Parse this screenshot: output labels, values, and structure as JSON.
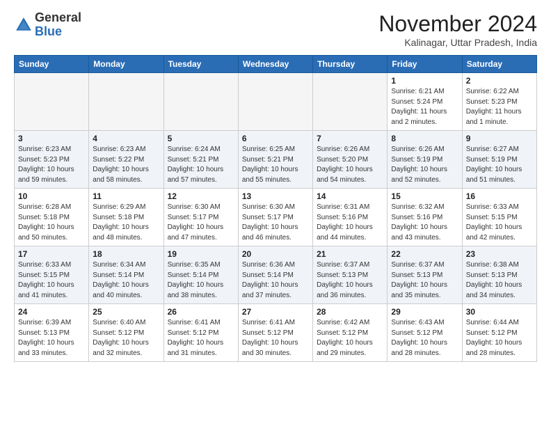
{
  "header": {
    "logo_general": "General",
    "logo_blue": "Blue",
    "month_title": "November 2024",
    "subtitle": "Kalinagar, Uttar Pradesh, India"
  },
  "days_of_week": [
    "Sunday",
    "Monday",
    "Tuesday",
    "Wednesday",
    "Thursday",
    "Friday",
    "Saturday"
  ],
  "weeks": [
    [
      {
        "day": "",
        "info": ""
      },
      {
        "day": "",
        "info": ""
      },
      {
        "day": "",
        "info": ""
      },
      {
        "day": "",
        "info": ""
      },
      {
        "day": "",
        "info": ""
      },
      {
        "day": "1",
        "info": "Sunrise: 6:21 AM\nSunset: 5:24 PM\nDaylight: 11 hours\nand 2 minutes."
      },
      {
        "day": "2",
        "info": "Sunrise: 6:22 AM\nSunset: 5:23 PM\nDaylight: 11 hours\nand 1 minute."
      }
    ],
    [
      {
        "day": "3",
        "info": "Sunrise: 6:23 AM\nSunset: 5:23 PM\nDaylight: 10 hours\nand 59 minutes."
      },
      {
        "day": "4",
        "info": "Sunrise: 6:23 AM\nSunset: 5:22 PM\nDaylight: 10 hours\nand 58 minutes."
      },
      {
        "day": "5",
        "info": "Sunrise: 6:24 AM\nSunset: 5:21 PM\nDaylight: 10 hours\nand 57 minutes."
      },
      {
        "day": "6",
        "info": "Sunrise: 6:25 AM\nSunset: 5:21 PM\nDaylight: 10 hours\nand 55 minutes."
      },
      {
        "day": "7",
        "info": "Sunrise: 6:26 AM\nSunset: 5:20 PM\nDaylight: 10 hours\nand 54 minutes."
      },
      {
        "day": "8",
        "info": "Sunrise: 6:26 AM\nSunset: 5:19 PM\nDaylight: 10 hours\nand 52 minutes."
      },
      {
        "day": "9",
        "info": "Sunrise: 6:27 AM\nSunset: 5:19 PM\nDaylight: 10 hours\nand 51 minutes."
      }
    ],
    [
      {
        "day": "10",
        "info": "Sunrise: 6:28 AM\nSunset: 5:18 PM\nDaylight: 10 hours\nand 50 minutes."
      },
      {
        "day": "11",
        "info": "Sunrise: 6:29 AM\nSunset: 5:18 PM\nDaylight: 10 hours\nand 48 minutes."
      },
      {
        "day": "12",
        "info": "Sunrise: 6:30 AM\nSunset: 5:17 PM\nDaylight: 10 hours\nand 47 minutes."
      },
      {
        "day": "13",
        "info": "Sunrise: 6:30 AM\nSunset: 5:17 PM\nDaylight: 10 hours\nand 46 minutes."
      },
      {
        "day": "14",
        "info": "Sunrise: 6:31 AM\nSunset: 5:16 PM\nDaylight: 10 hours\nand 44 minutes."
      },
      {
        "day": "15",
        "info": "Sunrise: 6:32 AM\nSunset: 5:16 PM\nDaylight: 10 hours\nand 43 minutes."
      },
      {
        "day": "16",
        "info": "Sunrise: 6:33 AM\nSunset: 5:15 PM\nDaylight: 10 hours\nand 42 minutes."
      }
    ],
    [
      {
        "day": "17",
        "info": "Sunrise: 6:33 AM\nSunset: 5:15 PM\nDaylight: 10 hours\nand 41 minutes."
      },
      {
        "day": "18",
        "info": "Sunrise: 6:34 AM\nSunset: 5:14 PM\nDaylight: 10 hours\nand 40 minutes."
      },
      {
        "day": "19",
        "info": "Sunrise: 6:35 AM\nSunset: 5:14 PM\nDaylight: 10 hours\nand 38 minutes."
      },
      {
        "day": "20",
        "info": "Sunrise: 6:36 AM\nSunset: 5:14 PM\nDaylight: 10 hours\nand 37 minutes."
      },
      {
        "day": "21",
        "info": "Sunrise: 6:37 AM\nSunset: 5:13 PM\nDaylight: 10 hours\nand 36 minutes."
      },
      {
        "day": "22",
        "info": "Sunrise: 6:37 AM\nSunset: 5:13 PM\nDaylight: 10 hours\nand 35 minutes."
      },
      {
        "day": "23",
        "info": "Sunrise: 6:38 AM\nSunset: 5:13 PM\nDaylight: 10 hours\nand 34 minutes."
      }
    ],
    [
      {
        "day": "24",
        "info": "Sunrise: 6:39 AM\nSunset: 5:13 PM\nDaylight: 10 hours\nand 33 minutes."
      },
      {
        "day": "25",
        "info": "Sunrise: 6:40 AM\nSunset: 5:12 PM\nDaylight: 10 hours\nand 32 minutes."
      },
      {
        "day": "26",
        "info": "Sunrise: 6:41 AM\nSunset: 5:12 PM\nDaylight: 10 hours\nand 31 minutes."
      },
      {
        "day": "27",
        "info": "Sunrise: 6:41 AM\nSunset: 5:12 PM\nDaylight: 10 hours\nand 30 minutes."
      },
      {
        "day": "28",
        "info": "Sunrise: 6:42 AM\nSunset: 5:12 PM\nDaylight: 10 hours\nand 29 minutes."
      },
      {
        "day": "29",
        "info": "Sunrise: 6:43 AM\nSunset: 5:12 PM\nDaylight: 10 hours\nand 28 minutes."
      },
      {
        "day": "30",
        "info": "Sunrise: 6:44 AM\nSunset: 5:12 PM\nDaylight: 10 hours\nand 28 minutes."
      }
    ]
  ]
}
